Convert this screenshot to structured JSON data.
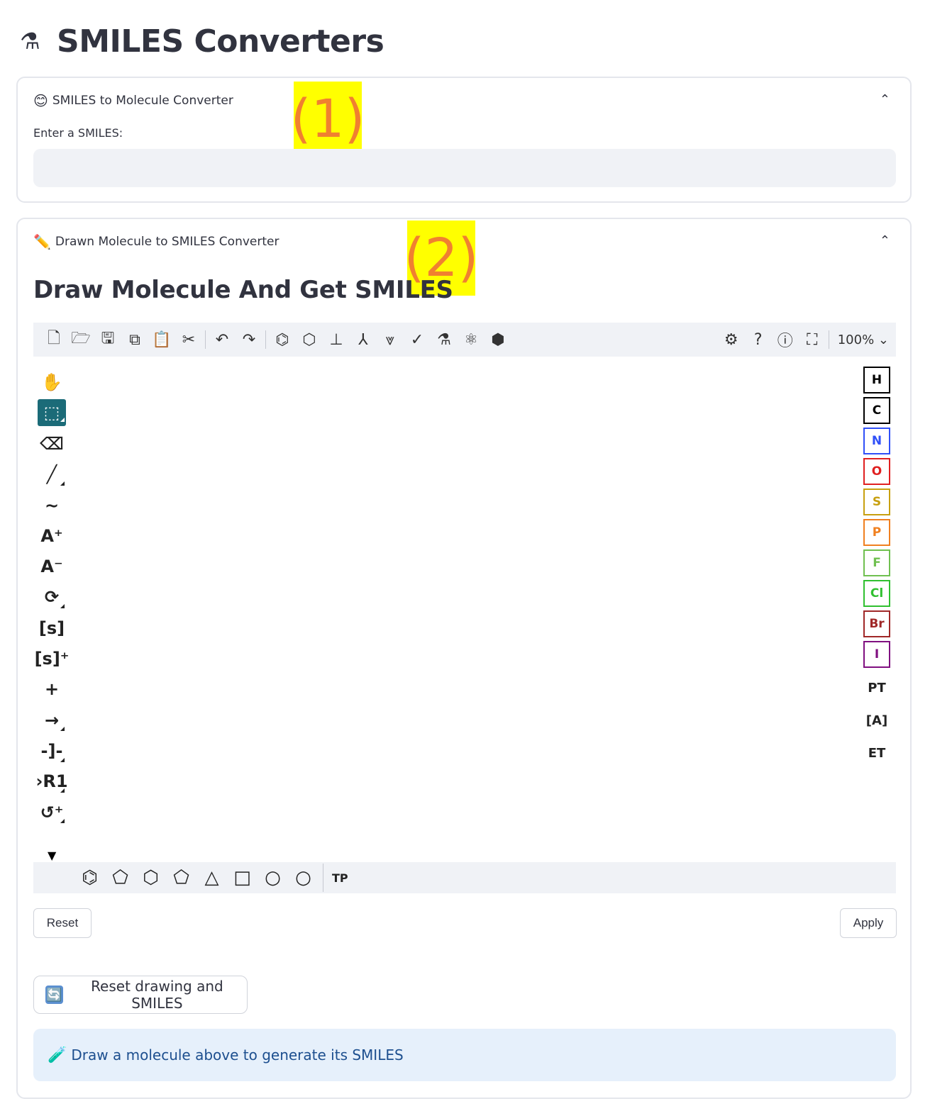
{
  "page": {
    "title": "SMILES Converters",
    "title_icon": "⚗"
  },
  "expander1": {
    "emoji": "😊",
    "title": "SMILES to Molecule Converter",
    "input_label": "Enter a SMILES:",
    "input_value": "",
    "annotation": "(1)"
  },
  "expander2": {
    "emoji": "✏️",
    "title": "Drawn Molecule to SMILES Converter",
    "annotation": "(2)",
    "heading": "Draw Molecule And Get SMILES"
  },
  "editor": {
    "toolbar_left": [
      {
        "icon": "new-file-icon",
        "glyph": "🗋"
      },
      {
        "icon": "open-folder-icon",
        "glyph": "🗁"
      },
      {
        "icon": "save-icon",
        "glyph": "🖫"
      },
      {
        "icon": "copy-icon",
        "glyph": "⧉"
      },
      {
        "icon": "paste-icon",
        "glyph": "📋"
      },
      {
        "icon": "cut-icon",
        "glyph": "✂"
      }
    ],
    "toolbar_history": [
      {
        "icon": "undo-icon",
        "glyph": "↶"
      },
      {
        "icon": "redo-icon",
        "glyph": "↷"
      }
    ],
    "toolbar_chem": [
      {
        "icon": "aromatize-icon",
        "glyph": "⌬"
      },
      {
        "icon": "dearomatize-icon",
        "glyph": "⬡"
      },
      {
        "icon": "layout-icon",
        "glyph": "⊥"
      },
      {
        "icon": "clean-icon",
        "glyph": "⅄"
      },
      {
        "icon": "stereo-icon",
        "glyph": "⩔"
      },
      {
        "icon": "check-icon",
        "glyph": "✓"
      },
      {
        "icon": "analyse-icon",
        "glyph": "⚗"
      },
      {
        "icon": "mapping-icon",
        "glyph": "⚛"
      },
      {
        "icon": "3d-view-icon",
        "glyph": "⬢"
      }
    ],
    "toolbar_right": [
      {
        "icon": "settings-icon",
        "glyph": "⚙"
      },
      {
        "icon": "help-icon",
        "glyph": "?"
      },
      {
        "icon": "about-icon",
        "glyph": "ⓘ"
      },
      {
        "icon": "fullscreen-icon",
        "glyph": "⛶"
      }
    ],
    "zoom": "100%",
    "left_tools": [
      {
        "icon": "hand-icon",
        "glyph": "✋",
        "corner": false,
        "active": false
      },
      {
        "icon": "select-icon",
        "glyph": "⬚",
        "corner": true,
        "active": true
      },
      {
        "icon": "eraser-icon",
        "glyph": "⌫",
        "corner": false,
        "active": false
      },
      {
        "icon": "bond-icon",
        "glyph": "╱",
        "corner": true,
        "active": false
      },
      {
        "icon": "chain-icon",
        "glyph": "∼",
        "corner": false,
        "active": false
      },
      {
        "icon": "charge-plus-icon",
        "glyph": "A⁺",
        "corner": false,
        "active": false
      },
      {
        "icon": "charge-minus-icon",
        "glyph": "A⁻",
        "corner": false,
        "active": false
      },
      {
        "icon": "rotate-icon",
        "glyph": "⟳",
        "corner": true,
        "active": false
      },
      {
        "icon": "sgroup-icon",
        "glyph": "[s]",
        "corner": false,
        "active": false
      },
      {
        "icon": "sgroup-add-icon",
        "glyph": "[s]⁺",
        "corner": false,
        "active": false
      },
      {
        "icon": "plus-icon",
        "glyph": "+",
        "corner": false,
        "active": false
      },
      {
        "icon": "reaction-arrow-icon",
        "glyph": "→",
        "corner": true,
        "active": false
      },
      {
        "icon": "reaction-map-icon",
        "glyph": "-]-",
        "corner": true,
        "active": false
      },
      {
        "icon": "rgroup-icon",
        "glyph": "›R1",
        "corner": true,
        "active": false
      },
      {
        "icon": "template-add-icon",
        "glyph": "↺⁺",
        "corner": true,
        "active": false
      }
    ],
    "atoms": [
      {
        "symbol": "H",
        "color": "#000000"
      },
      {
        "symbol": "C",
        "color": "#000000"
      },
      {
        "symbol": "N",
        "color": "#3050f8"
      },
      {
        "symbol": "O",
        "color": "#e02020"
      },
      {
        "symbol": "S",
        "color": "#c8a010"
      },
      {
        "symbol": "P",
        "color": "#f08020"
      },
      {
        "symbol": "F",
        "color": "#70c050"
      },
      {
        "symbol": "Cl",
        "color": "#30c030"
      },
      {
        "symbol": "Br",
        "color": "#a02828"
      },
      {
        "symbol": "I",
        "color": "#801080"
      }
    ],
    "right_extras": [
      {
        "icon": "periodic-table-icon",
        "glyph": "PT"
      },
      {
        "icon": "any-atom-icon",
        "glyph": "[A]"
      },
      {
        "icon": "extended-table-icon",
        "glyph": "ET"
      }
    ],
    "more_tools_glyph": "▼",
    "templates": [
      {
        "icon": "benzene-icon",
        "glyph": "⌬"
      },
      {
        "icon": "cyclopentadiene-icon",
        "glyph": "⬠"
      },
      {
        "icon": "cyclohexane-icon",
        "glyph": "⬡"
      },
      {
        "icon": "cyclopentane-icon",
        "glyph": "⬠"
      },
      {
        "icon": "cyclopropane-icon",
        "glyph": "△"
      },
      {
        "icon": "cyclobutane-icon",
        "glyph": "□"
      },
      {
        "icon": "cycloheptane-icon",
        "glyph": "○"
      },
      {
        "icon": "cyclooctane-icon",
        "glyph": "○"
      }
    ],
    "templates_label": "TP"
  },
  "buttons": {
    "reset": "Reset",
    "apply": "Apply",
    "reset_all_emoji": "🔄",
    "reset_all": "Reset drawing and SMILES"
  },
  "info": {
    "emoji": "🧪",
    "text": "Draw a molecule above to generate its SMILES"
  }
}
